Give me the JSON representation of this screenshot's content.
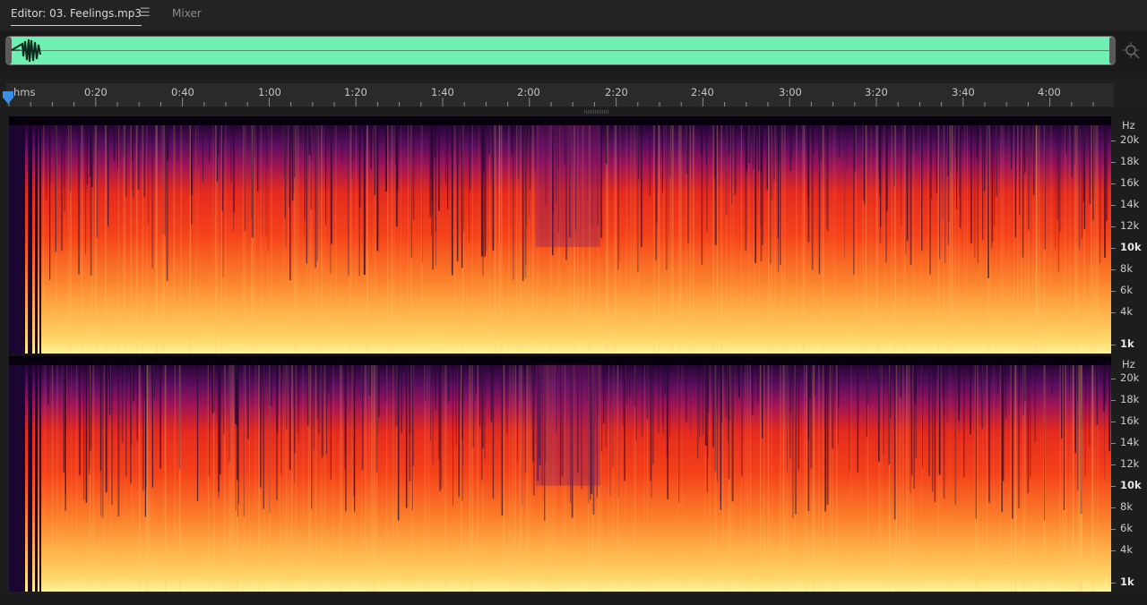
{
  "tabs": {
    "editor_label": "Editor: 03. Feelings.mp3",
    "mixer_label": "Mixer",
    "menu_icon": "hamburger-icon"
  },
  "overview": {
    "wave_color": "#6df0b2",
    "zoom_icon": "zoom-icon"
  },
  "ruler": {
    "unit_label": "hms",
    "labels": [
      "0:20",
      "0:40",
      "1:00",
      "1:20",
      "1:40",
      "2:00",
      "2:20",
      "2:40",
      "3:00",
      "3:20",
      "3:40",
      "4:00"
    ],
    "snap_icon": "magnet-icon"
  },
  "spectral": {
    "unit": "Hz",
    "top_labels": [
      "20k",
      "18k",
      "16k",
      "14k",
      "12k",
      "10k",
      "8k",
      "6k",
      "4k",
      "1k"
    ],
    "bottom_labels": [
      "20k",
      "18k",
      "16k",
      "14k",
      "12k",
      "10k",
      "8k",
      "6k",
      "4k",
      "1k"
    ],
    "colors": {
      "low": "#ffe98a",
      "mid": "#f5421a",
      "high": "#5a0e5e",
      "floor": "#0a0010"
    }
  }
}
